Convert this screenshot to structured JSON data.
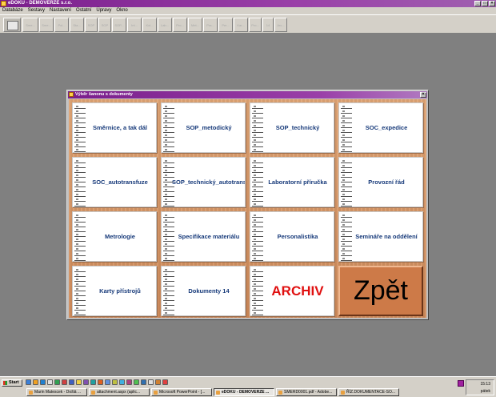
{
  "window": {
    "title": "eDOKU - DEMOVERZE s.r.o.",
    "min": "_",
    "max": "□",
    "close": "×"
  },
  "menu": [
    "Databáze",
    "Sestavy",
    "Nastavení",
    "Ostatní",
    "Úpravy",
    "Okno"
  ],
  "toolbar": {
    "labels": [
      "Sme...",
      "Sme...",
      "Pol...",
      "Sta...",
      "SOP",
      "SOP",
      "SOP...",
      "Int...",
      "Kol...",
      "Lab...",
      "Pro...",
      "Met...",
      "Pra...",
      "Per...",
      "Kar...",
      "Pro...",
      "14",
      "Arc..."
    ]
  },
  "dialog": {
    "title": "Výběr šanonu s dokumenty",
    "close": "×",
    "cards": [
      "Směrnice, a tak dál",
      "SOP_metodický",
      "SOP_technický",
      "SOC_expedice",
      "SOC_autotransfuze",
      "SOP_technický_autotransfuze",
      "Laboratorní příručka",
      "Provozní řád",
      "Metrologie",
      "Specifikace materiálu",
      "Personalistika",
      "Semináře na oddělení",
      "Karty přístrojů",
      "Dokumenty 14",
      "ARCHIV"
    ],
    "back_label": "Zpět"
  },
  "taskbar": {
    "start": "Start",
    "tasks": [
      "Marin Matescek - Došlá ...",
      "attachment.aspx (aplic...",
      "Microsoft PowerPoint - [...",
      "eDOKU - DEMOVERZE ...",
      "SMERD0001.pdf - Adobe...",
      "ŘÍZ.DOKUMENTACE-SO..."
    ],
    "time": "15:13",
    "day": "pátek"
  }
}
